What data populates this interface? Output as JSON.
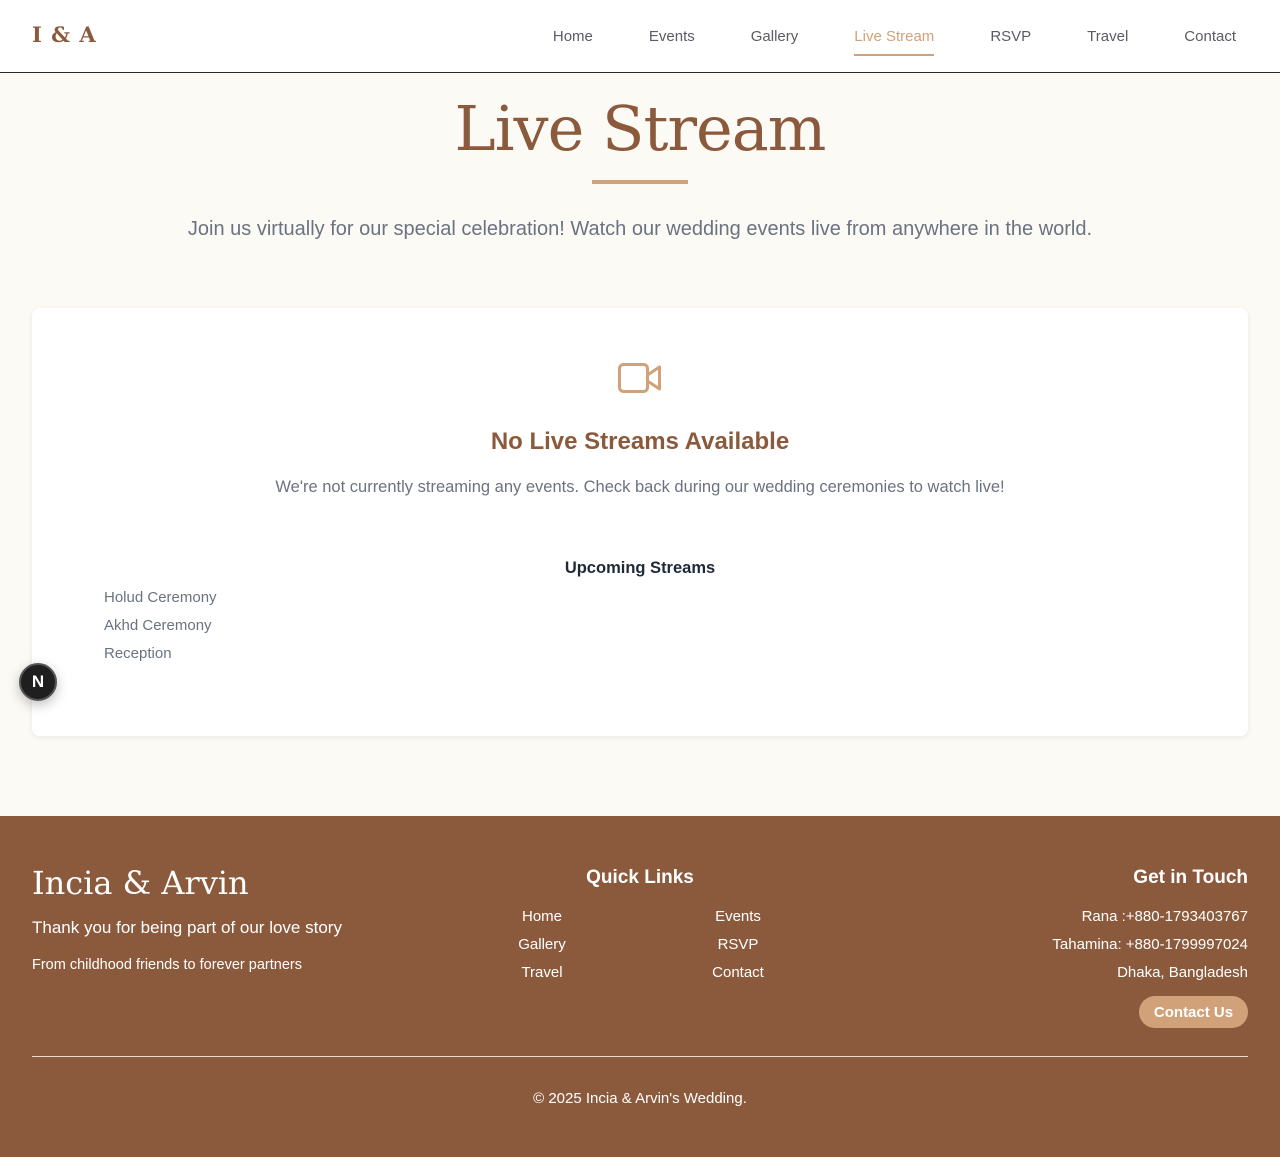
{
  "header": {
    "logo": "I & A",
    "nav": [
      {
        "label": "Home"
      },
      {
        "label": "Events"
      },
      {
        "label": "Gallery"
      },
      {
        "label": "Live Stream"
      },
      {
        "label": "RSVP"
      },
      {
        "label": "Travel"
      },
      {
        "label": "Contact"
      }
    ],
    "active_nav": "Live Stream"
  },
  "hero": {
    "title": "Live Stream",
    "subtitle": "Join us virtually for our special celebration! Watch our wedding events live from anywhere in the world."
  },
  "stream_card": {
    "icon": "video-camera-icon",
    "empty_title": "No Live Streams Available",
    "empty_text": "We're not currently streaming any events. Check back during our wedding ceremonies to watch live!",
    "upcoming_title": "Upcoming Streams",
    "upcoming": [
      "Holud Ceremony",
      "Akhd Ceremony",
      "Reception"
    ]
  },
  "fab": {
    "label": "N"
  },
  "footer": {
    "brand": "Incia & Arvin",
    "tagline": "Thank you for being part of our love story",
    "sub": "From childhood friends to forever partners",
    "quick_links_title": "Quick Links",
    "quick_links": [
      "Home",
      "Events",
      "Gallery",
      "RSVP",
      "Travel",
      "Contact"
    ],
    "get_in_touch_title": "Get in Touch",
    "contacts": [
      "Rana :+880-1793403767",
      "Tahamina: +880-1799997024",
      "Dhaka, Bangladesh"
    ],
    "contact_button": "Contact Us",
    "copyright": "© 2025 Incia & Arvin's Wedding."
  },
  "colors": {
    "brand_brown": "#8b5a3c",
    "accent_tan": "#d1a27a",
    "page_bg": "#fcfaf5"
  }
}
